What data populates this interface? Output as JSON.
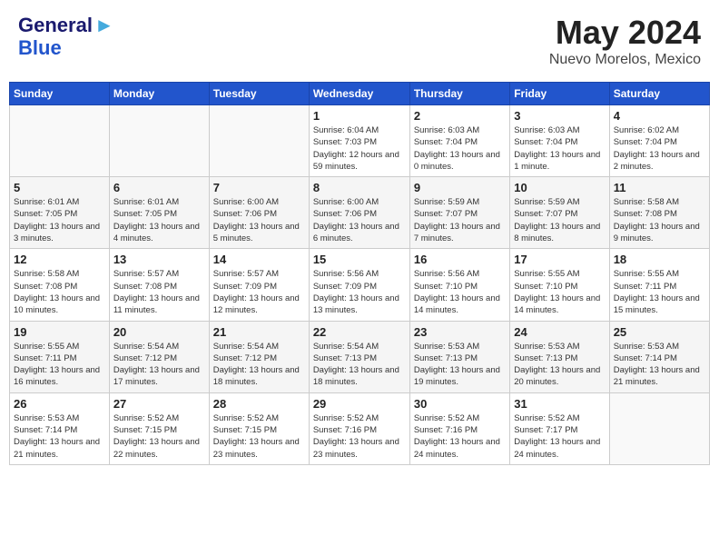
{
  "header": {
    "logo_general": "General",
    "logo_blue": "Blue",
    "month_title": "May 2024",
    "location": "Nuevo Morelos, Mexico"
  },
  "days_of_week": [
    "Sunday",
    "Monday",
    "Tuesday",
    "Wednesday",
    "Thursday",
    "Friday",
    "Saturday"
  ],
  "weeks": [
    [
      {
        "day": "",
        "content": ""
      },
      {
        "day": "",
        "content": ""
      },
      {
        "day": "",
        "content": ""
      },
      {
        "day": "1",
        "content": "Sunrise: 6:04 AM\nSunset: 7:03 PM\nDaylight: 12 hours and 59 minutes."
      },
      {
        "day": "2",
        "content": "Sunrise: 6:03 AM\nSunset: 7:04 PM\nDaylight: 13 hours and 0 minutes."
      },
      {
        "day": "3",
        "content": "Sunrise: 6:03 AM\nSunset: 7:04 PM\nDaylight: 13 hours and 1 minute."
      },
      {
        "day": "4",
        "content": "Sunrise: 6:02 AM\nSunset: 7:04 PM\nDaylight: 13 hours and 2 minutes."
      }
    ],
    [
      {
        "day": "5",
        "content": "Sunrise: 6:01 AM\nSunset: 7:05 PM\nDaylight: 13 hours and 3 minutes."
      },
      {
        "day": "6",
        "content": "Sunrise: 6:01 AM\nSunset: 7:05 PM\nDaylight: 13 hours and 4 minutes."
      },
      {
        "day": "7",
        "content": "Sunrise: 6:00 AM\nSunset: 7:06 PM\nDaylight: 13 hours and 5 minutes."
      },
      {
        "day": "8",
        "content": "Sunrise: 6:00 AM\nSunset: 7:06 PM\nDaylight: 13 hours and 6 minutes."
      },
      {
        "day": "9",
        "content": "Sunrise: 5:59 AM\nSunset: 7:07 PM\nDaylight: 13 hours and 7 minutes."
      },
      {
        "day": "10",
        "content": "Sunrise: 5:59 AM\nSunset: 7:07 PM\nDaylight: 13 hours and 8 minutes."
      },
      {
        "day": "11",
        "content": "Sunrise: 5:58 AM\nSunset: 7:08 PM\nDaylight: 13 hours and 9 minutes."
      }
    ],
    [
      {
        "day": "12",
        "content": "Sunrise: 5:58 AM\nSunset: 7:08 PM\nDaylight: 13 hours and 10 minutes."
      },
      {
        "day": "13",
        "content": "Sunrise: 5:57 AM\nSunset: 7:08 PM\nDaylight: 13 hours and 11 minutes."
      },
      {
        "day": "14",
        "content": "Sunrise: 5:57 AM\nSunset: 7:09 PM\nDaylight: 13 hours and 12 minutes."
      },
      {
        "day": "15",
        "content": "Sunrise: 5:56 AM\nSunset: 7:09 PM\nDaylight: 13 hours and 13 minutes."
      },
      {
        "day": "16",
        "content": "Sunrise: 5:56 AM\nSunset: 7:10 PM\nDaylight: 13 hours and 14 minutes."
      },
      {
        "day": "17",
        "content": "Sunrise: 5:55 AM\nSunset: 7:10 PM\nDaylight: 13 hours and 14 minutes."
      },
      {
        "day": "18",
        "content": "Sunrise: 5:55 AM\nSunset: 7:11 PM\nDaylight: 13 hours and 15 minutes."
      }
    ],
    [
      {
        "day": "19",
        "content": "Sunrise: 5:55 AM\nSunset: 7:11 PM\nDaylight: 13 hours and 16 minutes."
      },
      {
        "day": "20",
        "content": "Sunrise: 5:54 AM\nSunset: 7:12 PM\nDaylight: 13 hours and 17 minutes."
      },
      {
        "day": "21",
        "content": "Sunrise: 5:54 AM\nSunset: 7:12 PM\nDaylight: 13 hours and 18 minutes."
      },
      {
        "day": "22",
        "content": "Sunrise: 5:54 AM\nSunset: 7:13 PM\nDaylight: 13 hours and 18 minutes."
      },
      {
        "day": "23",
        "content": "Sunrise: 5:53 AM\nSunset: 7:13 PM\nDaylight: 13 hours and 19 minutes."
      },
      {
        "day": "24",
        "content": "Sunrise: 5:53 AM\nSunset: 7:13 PM\nDaylight: 13 hours and 20 minutes."
      },
      {
        "day": "25",
        "content": "Sunrise: 5:53 AM\nSunset: 7:14 PM\nDaylight: 13 hours and 21 minutes."
      }
    ],
    [
      {
        "day": "26",
        "content": "Sunrise: 5:53 AM\nSunset: 7:14 PM\nDaylight: 13 hours and 21 minutes."
      },
      {
        "day": "27",
        "content": "Sunrise: 5:52 AM\nSunset: 7:15 PM\nDaylight: 13 hours and 22 minutes."
      },
      {
        "day": "28",
        "content": "Sunrise: 5:52 AM\nSunset: 7:15 PM\nDaylight: 13 hours and 23 minutes."
      },
      {
        "day": "29",
        "content": "Sunrise: 5:52 AM\nSunset: 7:16 PM\nDaylight: 13 hours and 23 minutes."
      },
      {
        "day": "30",
        "content": "Sunrise: 5:52 AM\nSunset: 7:16 PM\nDaylight: 13 hours and 24 minutes."
      },
      {
        "day": "31",
        "content": "Sunrise: 5:52 AM\nSunset: 7:17 PM\nDaylight: 13 hours and 24 minutes."
      },
      {
        "day": "",
        "content": ""
      }
    ]
  ]
}
